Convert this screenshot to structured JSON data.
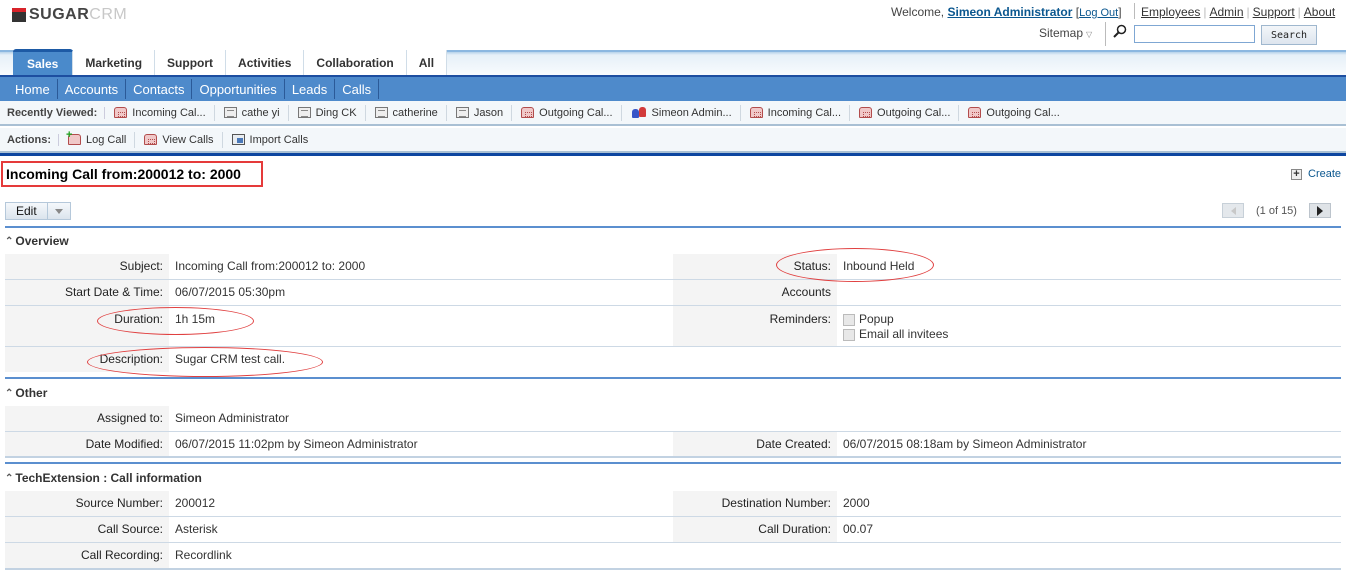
{
  "header": {
    "logo": {
      "sugar": "SUGAR",
      "crm": "CRM"
    },
    "welcome_prefix": "Welcome,",
    "user_name": "Simeon Administrator",
    "logout_label": "Log Out",
    "links": [
      "Employees",
      "Admin",
      "Support",
      "About"
    ],
    "sitemap_label": "Sitemap",
    "search": {
      "value": "",
      "placeholder": "",
      "button_label": "Search"
    }
  },
  "tabs": [
    "Sales",
    "Marketing",
    "Support",
    "Activities",
    "Collaboration",
    "All"
  ],
  "active_tab": "Sales",
  "subnav": [
    "Home",
    "Accounts",
    "Contacts",
    "Opportunities",
    "Leads",
    "Calls"
  ],
  "recently_viewed": {
    "label": "Recently Viewed:",
    "items": [
      {
        "label": "Incoming Cal...",
        "icon": "call-icon"
      },
      {
        "label": "cathe yi",
        "icon": "contact-card-icon"
      },
      {
        "label": "Ding CK",
        "icon": "contact-card-icon"
      },
      {
        "label": "catherine",
        "icon": "contact-card-icon"
      },
      {
        "label": "Jason",
        "icon": "contact-card-icon"
      },
      {
        "label": "Outgoing Cal...",
        "icon": "call-icon"
      },
      {
        "label": "Simeon Admin...",
        "icon": "users-icon"
      },
      {
        "label": "Incoming Cal...",
        "icon": "call-icon"
      },
      {
        "label": "Outgoing Cal...",
        "icon": "call-icon"
      },
      {
        "label": "Outgoing Cal...",
        "icon": "call-icon"
      }
    ]
  },
  "actions": {
    "label": "Actions:",
    "items": [
      {
        "label": "Log Call",
        "icon": "log-call-icon"
      },
      {
        "label": "View Calls",
        "icon": "call-icon"
      },
      {
        "label": "Import Calls",
        "icon": "import-icon"
      }
    ]
  },
  "record": {
    "title": "Incoming Call from:200012 to: 2000",
    "create_label": "Create",
    "edit_label": "Edit",
    "pager_text": "(1 of 15)"
  },
  "panels": {
    "overview": {
      "title": "Overview",
      "subject_label": "Subject:",
      "subject": "Incoming Call from:200012 to: 2000",
      "status_label": "Status:",
      "status": "Inbound Held",
      "start_label": "Start Date & Time:",
      "start": "06/07/2015 05:30pm",
      "accounts_label": "Accounts",
      "accounts": "",
      "duration_label": "Duration:",
      "duration": "1h 15m",
      "reminders_label": "Reminders:",
      "reminder_popup": "Popup",
      "reminder_popup_checked": false,
      "reminder_email": "Email all invitees",
      "reminder_email_checked": false,
      "description_label": "Description:",
      "description": "Sugar CRM test call."
    },
    "other": {
      "title": "Other",
      "assigned_label": "Assigned to:",
      "assigned": "Simeon Administrator",
      "modified_label": "Date Modified:",
      "modified": "06/07/2015 11:02pm by Simeon Administrator",
      "created_label": "Date Created:",
      "created": "06/07/2015 08:18am by Simeon Administrator"
    },
    "tech": {
      "title": "TechExtension : Call information",
      "source_label": "Source Number:",
      "source": "200012",
      "dest_label": "Destination Number:",
      "dest": "2000",
      "callsrc_label": "Call Source:",
      "callsrc": "Asterisk",
      "calldur_label": "Call Duration:",
      "calldur": "00.07",
      "rec_label": "Call Recording:",
      "rec": "Recordlink"
    }
  },
  "colors": {
    "accent": "#4e8acb",
    "tab_active": "#4a8acb",
    "annotation": "#e53a3a"
  }
}
